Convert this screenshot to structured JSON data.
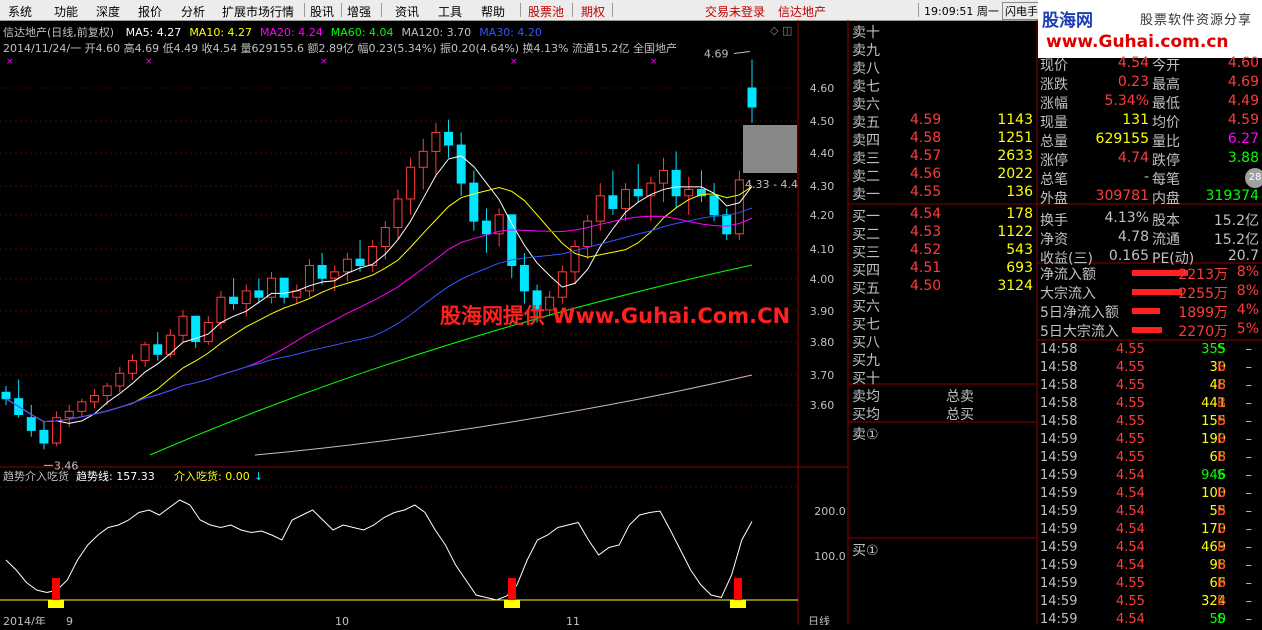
{
  "menu": {
    "items": [
      "系统",
      "功能",
      "深度",
      "报价",
      "分析",
      "扩展市场行情",
      "股讯",
      "增强",
      "资讯",
      "工具",
      "帮助",
      "股票池",
      "期权",
      "交易未登录",
      "信达地产"
    ],
    "clock": "19:09:51 周一",
    "flash": "闪电手"
  },
  "logo": {
    "line1": "股海网",
    "line1b": "股票软件资源分享",
    "line2": "www.Guhai.com.cn"
  },
  "stock": {
    "title": "信达地产(日线,前复权)",
    "ma": [
      {
        "label": "MA5: 4.27",
        "color": "#ffffff"
      },
      {
        "label": "MA10: 4.27",
        "color": "#ffff00"
      },
      {
        "label": "MA20: 4.24",
        "color": "#ff00ff"
      },
      {
        "label": "MA60: 4.04",
        "color": "#00ff00"
      },
      {
        "label": "MA120: 3.70",
        "color": "#c0c0c0"
      },
      {
        "label": "MA30: 4.20",
        "color": "#3355ff"
      }
    ],
    "info2": "2014/11/24/一 开4.60 高4.69 低4.49 收4.54 量629155.6 额2.89亿 幅0.23(5.34%) 振0.20(4.64%) 换4.13% 流通15.2亿 全国地产",
    "high_label": "4.69",
    "low_label": "3.46",
    "range_label": "4.33 - 4.4"
  },
  "price_scale": [
    "4.60",
    "4.50",
    "4.40",
    "4.30",
    "4.20",
    "4.10",
    "4.00",
    "3.90",
    "3.80",
    "3.70",
    "3.60"
  ],
  "indicator": {
    "name": "趋势介入吃货",
    "line_label": "趋势线: 157.33",
    "buy_label": "介入吃货: 0.00",
    "scale": [
      "200.0",
      "100.0"
    ],
    "date_labels": [
      "2014/年",
      "9",
      "10",
      "11"
    ],
    "corner": "日线"
  },
  "orderbook": {
    "asks": [
      {
        "label": "卖十",
        "price": "",
        "vol": ""
      },
      {
        "label": "卖九",
        "price": "",
        "vol": ""
      },
      {
        "label": "卖八",
        "price": "",
        "vol": ""
      },
      {
        "label": "卖七",
        "price": "",
        "vol": ""
      },
      {
        "label": "卖六",
        "price": "",
        "vol": ""
      },
      {
        "label": "卖五",
        "price": "4.59",
        "vol": "1143"
      },
      {
        "label": "卖四",
        "price": "4.58",
        "vol": "1251"
      },
      {
        "label": "卖三",
        "price": "4.57",
        "vol": "2633"
      },
      {
        "label": "卖二",
        "price": "4.56",
        "vol": "2022"
      },
      {
        "label": "卖一",
        "price": "4.55",
        "vol": "136"
      }
    ],
    "bids": [
      {
        "label": "买一",
        "price": "4.54",
        "vol": "178"
      },
      {
        "label": "买二",
        "price": "4.53",
        "vol": "1122"
      },
      {
        "label": "买三",
        "price": "4.52",
        "vol": "543"
      },
      {
        "label": "买四",
        "price": "4.51",
        "vol": "693"
      },
      {
        "label": "买五",
        "price": "4.50",
        "vol": "3124"
      },
      {
        "label": "买六",
        "price": "",
        "vol": ""
      },
      {
        "label": "买七",
        "price": "",
        "vol": ""
      },
      {
        "label": "买八",
        "price": "",
        "vol": ""
      },
      {
        "label": "买九",
        "price": "",
        "vol": ""
      },
      {
        "label": "买十",
        "price": "",
        "vol": ""
      }
    ],
    "ask_avg": "卖均",
    "bid_avg": "买均",
    "total_ask": "总卖",
    "total_bid": "总买",
    "sell1": "卖①",
    "buy1": "买①"
  },
  "quote": [
    {
      "l": "现价",
      "v": "4.54",
      "vc": "#ff3b3b",
      "l2": "今开",
      "v2": "4.60",
      "v2c": "#ff3b3b"
    },
    {
      "l": "涨跌",
      "v": "0.23",
      "vc": "#ff3b3b",
      "l2": "最高",
      "v2": "4.69",
      "v2c": "#ff3b3b"
    },
    {
      "l": "涨幅",
      "v": "5.34%",
      "vc": "#ff3b3b",
      "l2": "最低",
      "v2": "4.49",
      "v2c": "#ff3b3b"
    },
    {
      "l": "现量",
      "v": "131",
      "vc": "#ffff00",
      "l2": "均价",
      "v2": "4.59",
      "v2c": "#ff3b3b"
    },
    {
      "l": "总量",
      "v": "629155",
      "vc": "#ffff00",
      "l2": "量比",
      "v2": "6.27",
      "v2c": "#ff00ff"
    },
    {
      "l": "涨停",
      "v": "4.74",
      "vc": "#ff3b3b",
      "l2": "跌停",
      "v2": "3.88",
      "v2c": "#00ff00"
    },
    {
      "l": "总笔",
      "v": "-",
      "vc": "#c0c0c0",
      "l2": "每笔",
      "v2": "-",
      "v2c": "#c0c0c0"
    },
    {
      "l": "外盘",
      "v": "309781",
      "vc": "#ff3b3b",
      "l2": "内盘",
      "v2": "319374",
      "v2c": "#00ff00"
    },
    {
      "l": "换手",
      "v": "4.13%",
      "vc": "#c0c0c0",
      "l2": "股本",
      "v2": "15.2亿",
      "v2c": "#c0c0c0"
    },
    {
      "l": "净资",
      "v": "4.78",
      "vc": "#c0c0c0",
      "l2": "流通",
      "v2": "15.2亿",
      "v2c": "#c0c0c0"
    },
    {
      "l": "收益(三)",
      "v": "0.165",
      "vc": "#c0c0c0",
      "l2": "PE(动)",
      "v2": "20.7",
      "v2c": "#c0c0c0"
    }
  ],
  "badge": "28",
  "flows": [
    {
      "l": "净流入额",
      "v": "2213万",
      "p": "8%"
    },
    {
      "l": "大宗流入",
      "v": "2255万",
      "p": "8%"
    },
    {
      "l": "5日净流入额",
      "v": "1899万",
      "p": "4%"
    },
    {
      "l": "5日大宗流入",
      "v": "2270万",
      "p": "5%"
    }
  ],
  "ticks": [
    {
      "t": "14:58",
      "p": "4.55",
      "v": "355",
      "s": "S"
    },
    {
      "t": "14:58",
      "p": "4.55",
      "v": "30",
      "s": "B"
    },
    {
      "t": "14:58",
      "p": "4.55",
      "v": "48",
      "s": "B"
    },
    {
      "t": "14:58",
      "p": "4.55",
      "v": "441",
      "s": "B"
    },
    {
      "t": "14:58",
      "p": "4.55",
      "v": "155",
      "s": "B"
    },
    {
      "t": "14:59",
      "p": "4.55",
      "v": "190",
      "s": "B"
    },
    {
      "t": "14:59",
      "p": "4.55",
      "v": "68",
      "s": "B"
    },
    {
      "t": "14:59",
      "p": "4.54",
      "v": "946",
      "s": "S"
    },
    {
      "t": "14:59",
      "p": "4.54",
      "v": "100",
      "s": "B"
    },
    {
      "t": "14:59",
      "p": "4.54",
      "v": "55",
      "s": "B"
    },
    {
      "t": "14:59",
      "p": "4.54",
      "v": "170",
      "s": "B"
    },
    {
      "t": "14:59",
      "p": "4.54",
      "v": "469",
      "s": "B"
    },
    {
      "t": "14:59",
      "p": "4.54",
      "v": "98",
      "s": "B"
    },
    {
      "t": "14:59",
      "p": "4.55",
      "v": "66",
      "s": "B"
    },
    {
      "t": "14:59",
      "p": "4.55",
      "v": "324",
      "s": "B"
    },
    {
      "t": "14:59",
      "p": "4.54",
      "v": "50",
      "s": "S"
    }
  ],
  "watermark": "股海网提供 Www.Guhai.Com.CN",
  "candles": [
    [
      3.64,
      3.66,
      3.6,
      3.62
    ],
    [
      3.62,
      3.68,
      3.56,
      3.57
    ],
    [
      3.56,
      3.6,
      3.5,
      3.52
    ],
    [
      3.52,
      3.55,
      3.46,
      3.48
    ],
    [
      3.48,
      3.58,
      3.47,
      3.56
    ],
    [
      3.56,
      3.6,
      3.53,
      3.58
    ],
    [
      3.58,
      3.62,
      3.56,
      3.61
    ],
    [
      3.61,
      3.65,
      3.59,
      3.63
    ],
    [
      3.63,
      3.67,
      3.6,
      3.66
    ],
    [
      3.66,
      3.72,
      3.64,
      3.7
    ],
    [
      3.7,
      3.76,
      3.68,
      3.74
    ],
    [
      3.74,
      3.8,
      3.72,
      3.79
    ],
    [
      3.79,
      3.83,
      3.74,
      3.76
    ],
    [
      3.76,
      3.84,
      3.75,
      3.82
    ],
    [
      3.82,
      3.9,
      3.8,
      3.88
    ],
    [
      3.88,
      3.86,
      3.78,
      3.8
    ],
    [
      3.8,
      3.88,
      3.79,
      3.86
    ],
    [
      3.86,
      3.96,
      3.84,
      3.94
    ],
    [
      3.94,
      4.0,
      3.9,
      3.92
    ],
    [
      3.92,
      3.98,
      3.88,
      3.96
    ],
    [
      3.96,
      4.0,
      3.92,
      3.94
    ],
    [
      3.94,
      4.02,
      3.92,
      4.0
    ],
    [
      4.0,
      3.99,
      3.92,
      3.94
    ],
    [
      3.94,
      3.98,
      3.92,
      3.96
    ],
    [
      3.96,
      4.06,
      3.94,
      4.04
    ],
    [
      4.04,
      4.08,
      3.98,
      4.0
    ],
    [
      4.0,
      4.04,
      3.96,
      4.02
    ],
    [
      4.02,
      4.08,
      3.99,
      4.06
    ],
    [
      4.06,
      4.12,
      4.02,
      4.04
    ],
    [
      4.04,
      4.12,
      4.02,
      4.1
    ],
    [
      4.1,
      4.18,
      4.06,
      4.16
    ],
    [
      4.16,
      4.28,
      4.12,
      4.25
    ],
    [
      4.25,
      4.38,
      4.2,
      4.35
    ],
    [
      4.35,
      4.44,
      4.28,
      4.4
    ],
    [
      4.4,
      4.49,
      4.32,
      4.46
    ],
    [
      4.46,
      4.5,
      4.38,
      4.42
    ],
    [
      4.42,
      4.46,
      4.26,
      4.3
    ],
    [
      4.3,
      4.34,
      4.15,
      4.18
    ],
    [
      4.18,
      4.22,
      4.08,
      4.14
    ],
    [
      4.14,
      4.22,
      4.1,
      4.2
    ],
    [
      4.2,
      4.18,
      4.0,
      4.04
    ],
    [
      4.04,
      4.08,
      3.92,
      3.96
    ],
    [
      3.96,
      3.98,
      3.86,
      3.9
    ],
    [
      3.9,
      3.96,
      3.88,
      3.94
    ],
    [
      3.94,
      4.04,
      3.92,
      4.02
    ],
    [
      4.02,
      4.12,
      3.98,
      4.1
    ],
    [
      4.1,
      4.2,
      4.06,
      4.18
    ],
    [
      4.18,
      4.3,
      4.15,
      4.26
    ],
    [
      4.26,
      4.34,
      4.2,
      4.22
    ],
    [
      4.22,
      4.3,
      4.18,
      4.28
    ],
    [
      4.28,
      4.36,
      4.24,
      4.26
    ],
    [
      4.26,
      4.32,
      4.18,
      4.3
    ],
    [
      4.3,
      4.38,
      4.24,
      4.34
    ],
    [
      4.34,
      4.4,
      4.22,
      4.26
    ],
    [
      4.26,
      4.32,
      4.2,
      4.28
    ],
    [
      4.28,
      4.34,
      4.24,
      4.26
    ],
    [
      4.26,
      4.3,
      4.18,
      4.2
    ],
    [
      4.2,
      4.22,
      4.12,
      4.14
    ],
    [
      4.14,
      4.34,
      4.12,
      4.31
    ],
    [
      4.6,
      4.69,
      4.49,
      4.54
    ]
  ],
  "trend_line": [
    80,
    60,
    35,
    20,
    15,
    20,
    40,
    80,
    110,
    130,
    145,
    150,
    160,
    175,
    180,
    170,
    185,
    200,
    190,
    160,
    150,
    145,
    150,
    140,
    135,
    138,
    130,
    120,
    160,
    170,
    180,
    160,
    140,
    150,
    145,
    140,
    150,
    165,
    175,
    180,
    190,
    175,
    140,
    110,
    70,
    40,
    10,
    5,
    0,
    8,
    30,
    80,
    120,
    130,
    145,
    150,
    155,
    120,
    90,
    105,
    110,
    150,
    170,
    175,
    178,
    140,
    100,
    60,
    30,
    10,
    5,
    50,
    120,
    157
  ],
  "buy_marks": [
    0.1,
    0.5,
    0.92
  ]
}
